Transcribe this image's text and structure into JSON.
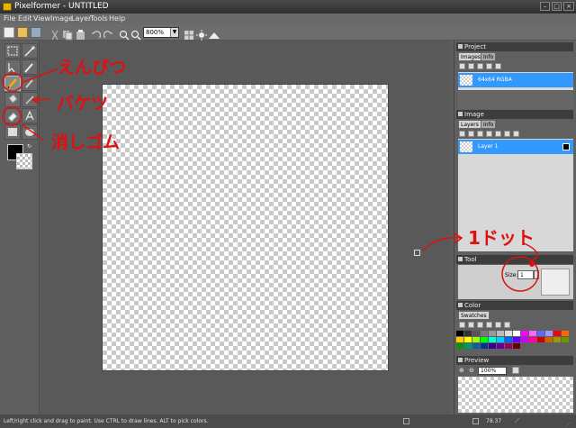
{
  "window": {
    "title": "Pixelformer - UNTITLED"
  },
  "menubar": [
    "File",
    "Edit",
    "View",
    "Image",
    "Layer",
    "Tools",
    "Help"
  ],
  "toolbar": {
    "zoom_value": "800%"
  },
  "panels": {
    "project": {
      "title": "Project",
      "tabs": [
        "Images",
        "Info"
      ],
      "item": "64x64 RGBA"
    },
    "image": {
      "title": "Image",
      "tabs": [
        "Layers",
        "Info"
      ],
      "layer": "Layer 1"
    },
    "tool": {
      "title": "Tool",
      "size_label": "Size:",
      "size_value": "1"
    },
    "color": {
      "title": "Color",
      "tabs": [
        "Swatches"
      ]
    },
    "preview": {
      "title": "Preview",
      "zoom_value": "100%"
    }
  },
  "statusbar": {
    "hint": "Left/right click and drag to paint. Use CTRL to draw lines. ALT to pick colors.",
    "coords": "78.37"
  },
  "annotations": {
    "pencil": "えんぴつ",
    "bucket": "バケツ",
    "eraser": "消しゴム",
    "dot": "1ドット"
  },
  "colors": {
    "accent": "#3399ff",
    "annotation": "#e01010",
    "swatches": [
      "#000000",
      "#333333",
      "#555555",
      "#777777",
      "#999999",
      "#bbbbbb",
      "#dddddd",
      "#ffffff",
      "#ff00ff",
      "#ff66ff",
      "#6666ff",
      "#9999ff",
      "#ff0000",
      "#ff6600",
      "#ffcc00",
      "#ffff00",
      "#99ff00",
      "#00ff00",
      "#00ffcc",
      "#00ccff",
      "#0066ff",
      "#6600ff",
      "#cc00ff",
      "#ff0099",
      "#cc0000",
      "#cc6600",
      "#999900",
      "#669900",
      "#009900",
      "#009966",
      "#006699",
      "#003399",
      "#330099",
      "#660099",
      "#990066",
      "#660000"
    ]
  }
}
